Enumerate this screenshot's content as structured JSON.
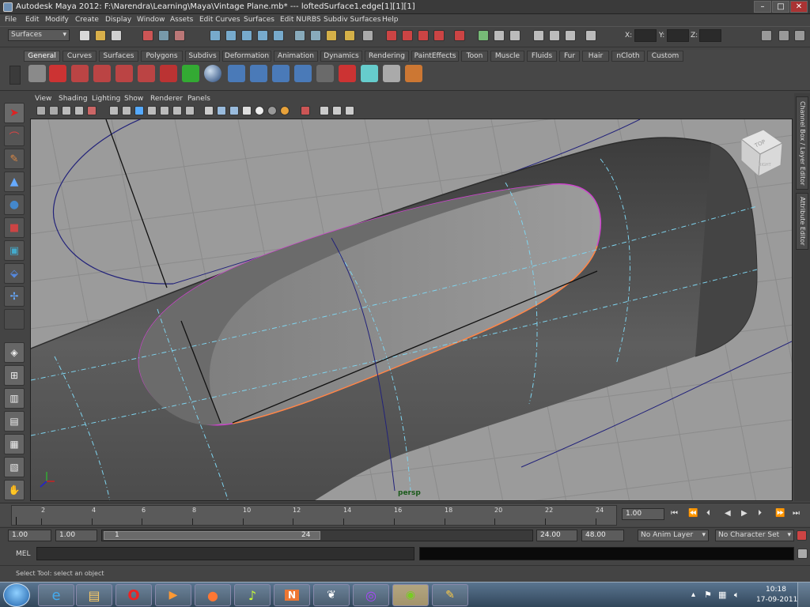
{
  "window": {
    "title": "Autodesk Maya 2012: F:\\Narendra\\Learning\\Maya\\Vintage Plane.mb*  ---  loftedSurface1.edge[1][1][1]",
    "minimize": "–",
    "maximize": "□",
    "close": "✕"
  },
  "menu": [
    "File",
    "Edit",
    "Modify",
    "Create",
    "Display",
    "Window",
    "Assets",
    "Edit Curves",
    "Surfaces",
    "Edit NURBS",
    "Subdiv Surfaces",
    "Help"
  ],
  "status_line": {
    "menuset": "Surfaces",
    "x_label": "X:",
    "y_label": "Y:",
    "z_label": "Z:"
  },
  "shelf": {
    "tabs": [
      "General",
      "Curves",
      "Surfaces",
      "Polygons",
      "Subdivs",
      "Deformation",
      "Animation",
      "Dynamics",
      "Rendering",
      "PaintEffects",
      "Toon",
      "Muscle",
      "Fluids",
      "Fur",
      "Hair",
      "nCloth",
      "Custom"
    ],
    "active_tab": "General"
  },
  "panel_menu": [
    "View",
    "Shading",
    "Lighting",
    "Show",
    "Renderer",
    "Panels"
  ],
  "viewport": {
    "camera_name": "persp",
    "viewcube_top": "TOP",
    "viewcube_right": "RIGHT"
  },
  "right_tabs": {
    "channel_box": "Channel Box / Layer Editor",
    "attribute_editor": "Attribute Editor"
  },
  "timeline": {
    "ticks": [
      "2",
      "4",
      "6",
      "8",
      "10",
      "12",
      "14",
      "16",
      "18",
      "20",
      "22",
      "24"
    ],
    "current_time": "1.00"
  },
  "range": {
    "start_time": "1.00",
    "playback_start": "1.00",
    "slider_start": "1",
    "slider_end": "24",
    "playback_end": "24.00",
    "end_time": "48.00",
    "anim_layer": "No Anim Layer",
    "character_set": "No Character Set"
  },
  "command_line": {
    "label": "MEL"
  },
  "help_line": "Select Tool: select an object",
  "taskbar": {
    "time": "10:18",
    "date": "17-09-2011"
  },
  "colors": {
    "viewport_bg": "#9b9b9b",
    "selection_magenta": "#d040d0",
    "isoparm_cyan": "#7fd4ef",
    "curve_navy": "#22227a"
  }
}
